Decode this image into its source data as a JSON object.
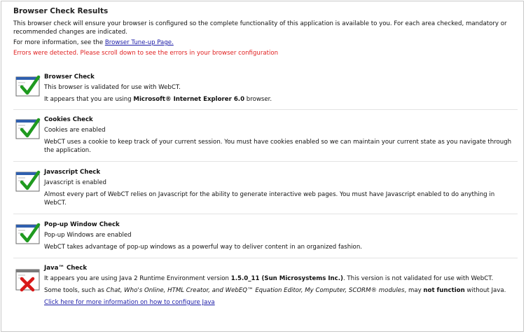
{
  "page": {
    "title": "Browser Check Results",
    "intro_text": "This browser check will ensure your browser is configured so the complete functionality of this application is available to you. For each area checked, mandatory or recommended changes are indicated.",
    "more_info_prefix": "For more information, see the ",
    "tune_up_link": "Browser Tune-up Page.",
    "error_message": "Errors were detected. Please scroll down to see the errors in your browser configuration"
  },
  "checks": {
    "browser": {
      "title": "Browser Check",
      "status": "This browser is validated for use with WebCT.",
      "detail_prefix": "It appears that you are using ",
      "detail_bold": "Microsoft® Internet Explorer 6.0",
      "detail_suffix": " browser.",
      "icon": "check-pass-icon"
    },
    "cookies": {
      "title": "Cookies Check",
      "status": "Cookies are enabled",
      "detail": "WebCT uses a cookie to keep track of your current session. You must have cookies enabled so we can maintain your current state as you navigate through the application.",
      "icon": "check-pass-icon"
    },
    "javascript": {
      "title": "Javascript Check",
      "status": "Javascript is enabled",
      "detail": "Almost every part of WebCT relies on Javascript for the ability to generate interactive web pages. You must have Javascript enabled to do anything in WebCT.",
      "icon": "check-pass-icon"
    },
    "popup": {
      "title": "Pop-up Window Check",
      "status": "Pop-up Windows are enabled",
      "detail": "WebCT takes advantage of pop-up windows as a powerful way to deliver content in an organized fashion.",
      "icon": "check-pass-icon"
    },
    "java": {
      "title": "Java™ Check",
      "status_prefix": "It appears you are using Java 2 Runtime Environment version ",
      "status_bold": "1.5.0_11 (Sun Microsystems Inc.)",
      "status_suffix": ". This version is not validated for use with WebCT.",
      "tools_prefix": "Some tools, such as ",
      "tools_italic": "Chat, Who's Online, HTML Creator, and WebEQ™ Equation Editor, My Computer, SCORM® modules",
      "tools_mid": ", may ",
      "tools_bold": "not function",
      "tools_suffix": " without Java.",
      "config_link": "Click here for more information on how to configure Java",
      "icon": "check-fail-icon"
    }
  },
  "colors": {
    "error": "#e02020",
    "link": "#1a1aa6",
    "pass_check": "#1f9a1f",
    "fail_x": "#d81818",
    "window_blue": "#2f5fae"
  }
}
